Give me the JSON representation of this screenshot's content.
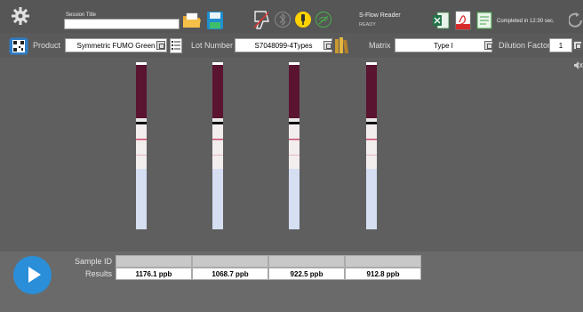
{
  "session": {
    "label": "Session Title",
    "value": ""
  },
  "reader": {
    "name": "S-Flow Reader",
    "status": "READY"
  },
  "completed_text": "Completed in 12:30 sec.",
  "form": {
    "product_label": "Product",
    "product_value": "Symmetric FUMO Green",
    "lot_label": "Lot Number",
    "lot_value": "S7048099-4Types",
    "matrix_label": "Matrix",
    "matrix_value": "Type I",
    "dilution_label": "Dilution Factor",
    "dilution_value": "1"
  },
  "results": {
    "sample_id_label": "Sample ID",
    "results_label": "Results",
    "sample_ids": [
      "",
      "",
      "",
      ""
    ],
    "values": [
      "1176.1 ppb",
      "1068.7 ppb",
      "922.5 ppb",
      "912.8 ppb"
    ]
  },
  "icons": {
    "settings": "gear-icon",
    "open": "folder-icon",
    "save": "save-icon",
    "scanner": "scanner-icon",
    "bluetooth": "bluetooth-icon",
    "usb": "usb-icon",
    "wifi": "wifi-icon",
    "excel": "excel-icon",
    "pdf": "pdf-icon",
    "report": "document-icon",
    "refresh": "refresh-icon",
    "qr": "qr-code-icon",
    "mute": "mute-icon",
    "play": "play-icon"
  },
  "colors": {
    "accent": "#2a8fd8",
    "strip_band": "#5a1430",
    "background": "#5c5c5c"
  }
}
